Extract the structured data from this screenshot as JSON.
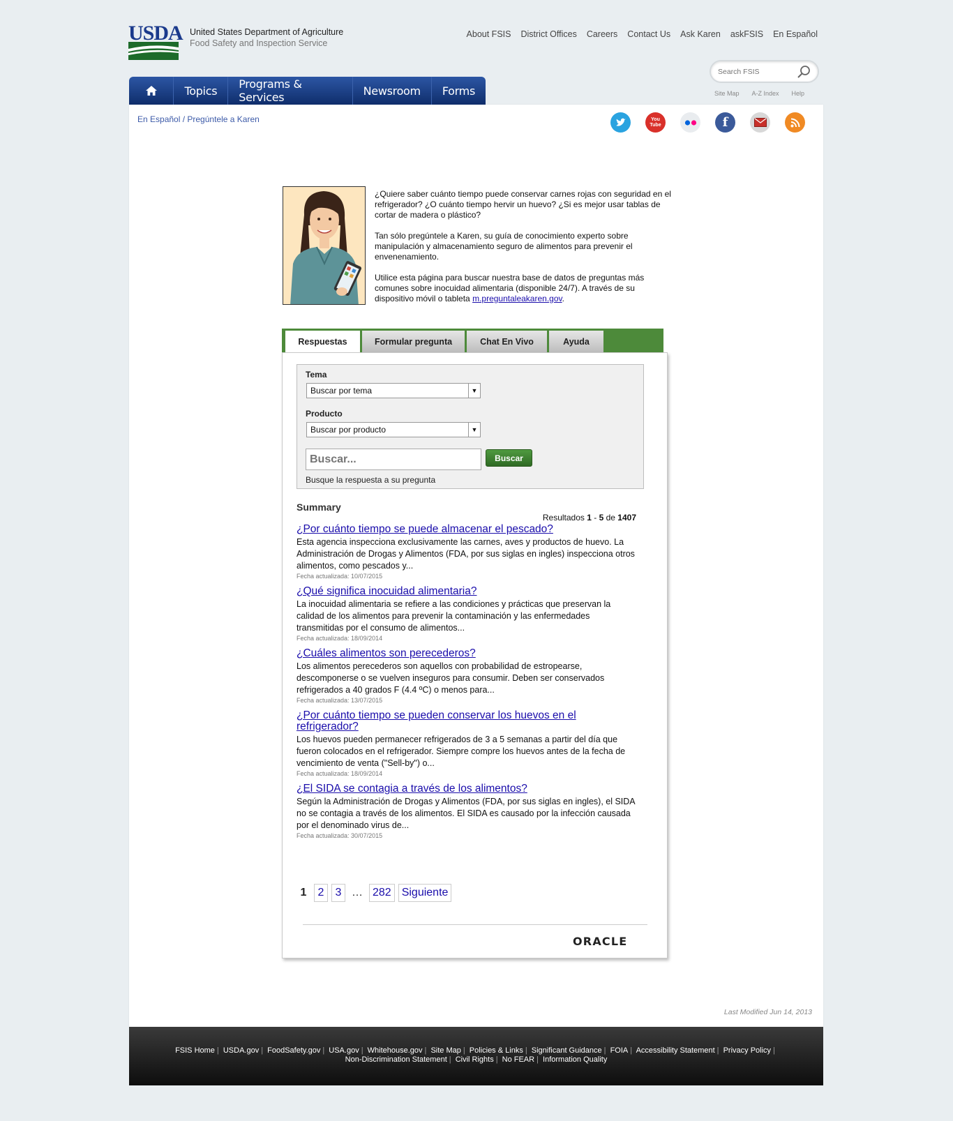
{
  "header": {
    "logo_text": "USDA",
    "agency_line1": "United States Department of Agriculture",
    "agency_line2": "Food Safety and Inspection Service",
    "top_links": [
      "About FSIS",
      "District Offices",
      "Careers",
      "Contact Us",
      "Ask Karen",
      "askFSIS",
      "En Español"
    ],
    "search_placeholder": "Search FSIS",
    "sub_links": [
      "Site Map",
      "A-Z Index",
      "Help"
    ]
  },
  "nav": {
    "items": [
      "Topics",
      "Programs & Services",
      "Newsroom",
      "Forms"
    ]
  },
  "breadcrumb": "En Español / Pregúntele a Karen",
  "social": [
    "twitter-icon",
    "youtube-icon",
    "flickr-icon",
    "facebook-icon",
    "email-icon",
    "rss-icon"
  ],
  "intro": {
    "p1": "¿Quiere saber cuánto tiempo puede conservar carnes rojas con seguridad en el refrigerador? ¿O cuánto tiempo hervir un huevo? ¿Si es mejor usar tablas de cortar de madera o plástico?",
    "p2": "Tan sólo pregúntele a Karen, su guía de conocimiento experto sobre manipulación y almacenamiento seguro de alimentos para prevenir el envenenamiento.",
    "p3": "Utilice esta página para buscar nuestra base de datos de preguntas más comunes sobre inocuidad alimentaria (disponible 24/7). A través de su dispositivo móvil o tableta ",
    "p3_link": "m.preguntaleakaren.gov",
    "p3_end": "."
  },
  "tabs": [
    "Respuestas",
    "Formular pregunta",
    "Chat En Vivo",
    "Ayuda"
  ],
  "filters": {
    "tema_label": "Tema",
    "tema_value": "Buscar por tema",
    "producto_label": "Producto",
    "producto_value": "Buscar por producto",
    "search_placeholder": "Buscar...",
    "search_button": "Buscar",
    "hint": "Busque la respuesta a su pregunta"
  },
  "summary": {
    "title": "Summary",
    "results_prefix": "Resultados ",
    "from": "1",
    "dash": " - ",
    "to": "5",
    "of": " de ",
    "total": "1407"
  },
  "results": [
    {
      "question": "¿Por cuánto tiempo se puede almacenar el pescado?",
      "answer": "Esta agencia inspecciona exclusivamente las carnes, aves y productos de huevo. La Administración de Drogas y Alimentos (FDA, por sus siglas en ingles) inspecciona otros alimentos, como pescados y...",
      "date": "Fecha actualizada: 10/07/2015"
    },
    {
      "question": "¿Qué significa inocuidad alimentaria?",
      "answer": "La inocuidad alimentaria se refiere a las condiciones y prácticas que preservan la calidad de los alimentos para prevenir la contaminación y las enfermedades transmitidas por el consumo de alimentos...",
      "date": "Fecha actualizada: 18/09/2014"
    },
    {
      "question": "¿Cuáles alimentos son perecederos?",
      "answer": "Los alimentos perecederos son aquellos con probabilidad de estropearse, descomponerse o se vuelven inseguros para consumir. Deben ser conservados refrigerados a 40 grados F (4.4 ºC) o menos para...",
      "date": "Fecha actualizada: 13/07/2015"
    },
    {
      "question": "¿Por cuánto tiempo se pueden conservar los huevos en el refrigerador?",
      "answer": "Los huevos pueden permanecer refrigerados de 3 a 5 semanas a partir del día que fueron colocados en el refrigerador. Siempre compre los huevos antes de la fecha de vencimiento de venta (\"Sell-by\") o...",
      "date": "Fecha actualizada: 18/09/2014"
    },
    {
      "question": "¿El SIDA se contagia a través de los alimentos?",
      "answer": "Según la Administración de Drogas y Alimentos (FDA, por sus siglas en ingles), el SIDA no se contagia a través de los alimentos. El SIDA es causado por la infección causada por el denominado virus de...",
      "date": "Fecha actualizada: 30/07/2015"
    }
  ],
  "pager": {
    "current": "1",
    "pages": [
      "2",
      "3"
    ],
    "ellipsis": "…",
    "last": "282",
    "next": "Siguiente"
  },
  "oracle": "ORACLE",
  "last_modified": "Last Modified Jun 14, 2013",
  "footer": {
    "row1": [
      "FSIS Home",
      "USDA.gov",
      "FoodSafety.gov",
      "USA.gov",
      "Whitehouse.gov",
      "Site Map",
      "Policies & Links",
      "Significant Guidance",
      "FOIA",
      "Accessibility Statement",
      "Privacy Policy"
    ],
    "row2": [
      "Non-Discrimination Statement",
      "Civil Rights",
      "No FEAR",
      "Information Quality"
    ]
  }
}
